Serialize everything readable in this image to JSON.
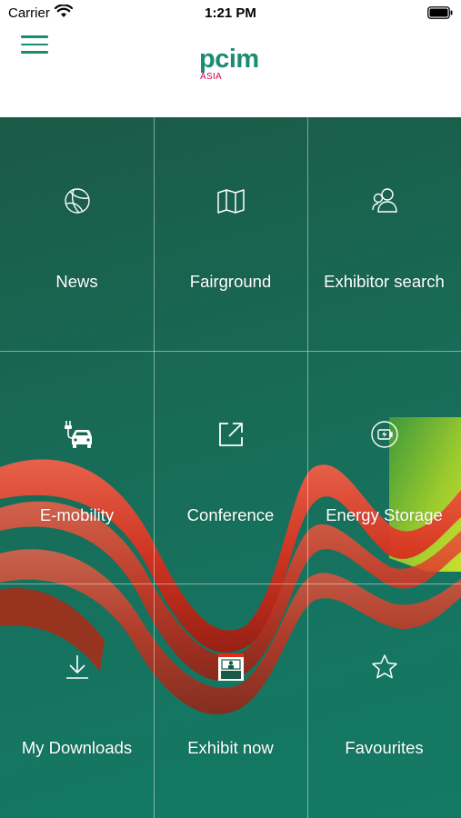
{
  "status_bar": {
    "carrier": "Carrier",
    "time": "1:21 PM"
  },
  "header": {
    "logo_text": "pcim",
    "logo_subtext": "ASIA",
    "brand_color": "#1a8c72",
    "accent_color": "#d8004a"
  },
  "tiles": [
    {
      "label": "News",
      "icon": "globe-icon"
    },
    {
      "label": "Fairground",
      "icon": "map-icon"
    },
    {
      "label": "Exhibitor search",
      "icon": "users-icon"
    },
    {
      "label": "E-mobility",
      "icon": "electric-car-icon"
    },
    {
      "label": "Conference",
      "icon": "external-link-icon"
    },
    {
      "label": "Energy Storage",
      "icon": "battery-charge-icon"
    },
    {
      "label": "My Downloads",
      "icon": "download-icon"
    },
    {
      "label": "Exhibit now",
      "icon": "exhibit-booth-icon"
    },
    {
      "label": "Favourites",
      "icon": "star-icon"
    }
  ]
}
